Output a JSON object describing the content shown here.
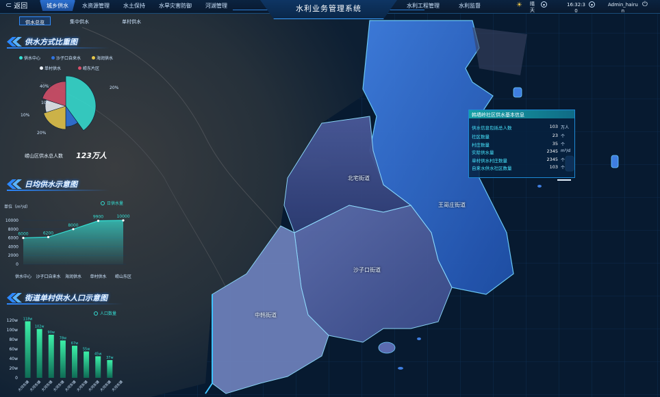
{
  "header": {
    "back_label": "返回",
    "title": "水利业务管理系统",
    "nav_left": [
      "城乡供水",
      "水资源管理",
      "水土保持",
      "水旱灾害防御",
      "河湖管理"
    ],
    "nav_right": [
      "水利工程管理",
      "水利监督"
    ],
    "active_nav": 0,
    "weather": "晴天",
    "time_line1": "16:32:3",
    "time_line2": "0",
    "user_line1": "Admin_hairu",
    "user_line2": "n"
  },
  "subtabs": [
    "供水总览",
    "集中供水",
    "单村供水"
  ],
  "active_subtab": 0,
  "supply_ratio": {
    "title": "供水方式比重图",
    "legend": [
      {
        "label": "供水中心",
        "color": "#35e0d4"
      },
      {
        "label": "沙子口自来水",
        "color": "#2f74e0"
      },
      {
        "label": "海润供水",
        "color": "#e8c84a"
      },
      {
        "label": "单村供水",
        "color": "#eef2f7"
      },
      {
        "label": "崂东片区",
        "color": "#d94f6a"
      }
    ],
    "pie_labels": [
      "20%",
      "40%",
      "10%",
      "20%",
      "10%"
    ],
    "population_label": "崂山区供水总人数",
    "population_value": "123万人"
  },
  "daily_supply": {
    "title": "日均供水示意图",
    "unit_label": "单位（m³/d）",
    "legend_label": "日供水量",
    "legend_color": "#35e0d4"
  },
  "street_population": {
    "title": "街道单村供水人口示意图",
    "legend_label": "人口数量",
    "legend_color": "#35e0d4"
  },
  "chart_data": [
    {
      "type": "pie",
      "categories": [
        "供水中心",
        "沙子口自来水",
        "海润供水",
        "单村供水",
        "崂东片区"
      ],
      "values": [
        40,
        10,
        20,
        10,
        20
      ],
      "colors": [
        "#35e0d4",
        "#2f74e0",
        "#e8c84a",
        "#eef2f7",
        "#d94f6a"
      ]
    },
    {
      "type": "area",
      "categories": [
        "供水中心",
        "沙子口自来水",
        "海润供水",
        "单村供水",
        "崂山东区"
      ],
      "series": [
        {
          "name": "日供水量",
          "values": [
            6000,
            6200,
            8000,
            9900,
            10000
          ]
        }
      ],
      "yticks": [
        "0",
        "2000",
        "4000",
        "6000",
        "8000",
        "10000"
      ],
      "ylim": [
        0,
        10000
      ]
    },
    {
      "type": "bar",
      "categories": [
        "大河东镇",
        "大河东镇",
        "大河东镇",
        "大河东镇",
        "大河东镇",
        "大河东镇",
        "大河东镇",
        "大河东镇",
        "大河东镇"
      ],
      "values": [
        118,
        102,
        90,
        78,
        67,
        55,
        45,
        37
      ],
      "data_labels": [
        "118w",
        "102w",
        "90w",
        "78w",
        "67w",
        "55w",
        "45w",
        "37w"
      ],
      "yticks": [
        "0",
        "20w",
        "40w",
        "60w",
        "80w",
        "100w",
        "120w"
      ],
      "ylim": [
        0,
        120
      ]
    }
  ],
  "map": {
    "labels": [
      "北宅街道",
      "王哥庄街道",
      "沙子口街道",
      "中韩街道"
    ]
  },
  "info_card": {
    "title": "韩墙岭社区供水基本信息",
    "rows": [
      {
        "key": "供水信息包括总人数",
        "value": "103",
        "unit": "万人"
      },
      {
        "key": "社区数量",
        "value": "23",
        "unit": "个"
      },
      {
        "key": "村庄数量",
        "value": "35",
        "unit": "个"
      },
      {
        "key": "实际供水量",
        "value": "2345",
        "unit": "m³/d"
      },
      {
        "key": "单村供水村庄数量",
        "value": "2345",
        "unit": "个"
      },
      {
        "key": "自来水供水社区数量",
        "value": "103",
        "unit": "个"
      }
    ]
  }
}
